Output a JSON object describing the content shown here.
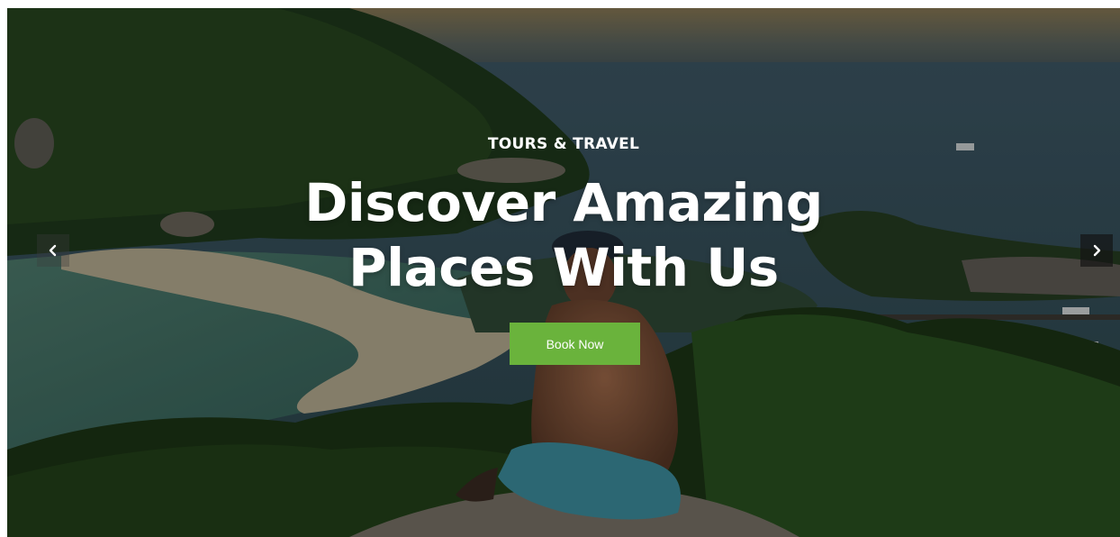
{
  "hero": {
    "subtitle": "TOURS & TRAVEL",
    "headline_line1": "Discover Amazing",
    "headline_line2": "Places With Us",
    "cta_label": "Book Now"
  },
  "slider": {
    "prev_icon": "chevron-left-icon",
    "next_icon": "chevron-right-icon"
  },
  "colors": {
    "cta_background": "#6ab33c",
    "text": "#ffffff"
  }
}
